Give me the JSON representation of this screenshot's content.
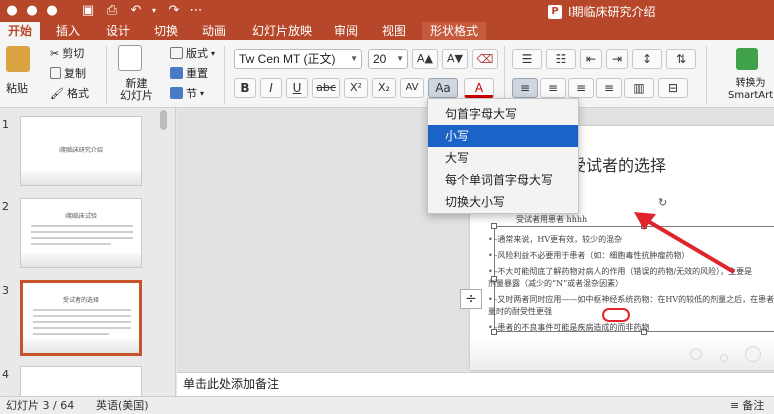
{
  "window": {
    "title": "I期临床研究介绍",
    "app_badge": "P"
  },
  "tabs": [
    "开始",
    "插入",
    "设计",
    "切换",
    "动画",
    "幻灯片放映",
    "审阅",
    "视图",
    "形状格式"
  ],
  "ribbon": {
    "paste": "粘贴",
    "cut": "剪切",
    "copy": "复制",
    "format": "格式",
    "new_slide": "新建\n幻灯片",
    "layout": "版式",
    "reset": "重置",
    "section": "节",
    "font_name": "Tw Cen MT (正文)",
    "font_size": "20",
    "bold": "B",
    "italic": "I",
    "underline": "U",
    "strike": "abc",
    "superscript": "X²",
    "subscript": "X₂",
    "char_spacing": "AV",
    "change_case": "Aa",
    "font_color": "A",
    "grow": "A▲",
    "shrink": "A▼",
    "convert_smartart": "转换为\nSmartArt"
  },
  "case_menu": {
    "items": [
      "句首字母大写",
      "小写",
      "大写",
      "每个单词首字母大写",
      "切换大小写"
    ],
    "hover_index": 1
  },
  "thumbnails": [
    {
      "num": "1",
      "title": "I期临床研究介绍"
    },
    {
      "num": "2",
      "title": "I期临床试验"
    },
    {
      "num": "3",
      "title": "受试者的选择"
    },
    {
      "num": "4",
      "title": ""
    }
  ],
  "slide": {
    "title": "受试者的选择",
    "lines": [
      "受试者用患者 hhhh",
      "-通常来说，HV更有效，较少的混杂",
      "-风险利益不必要用于患者（如：细胞毒性抗肿瘤药物）",
      "-不大可能彻底了解药物对病人的作用（错误的药物/无效的风险），主要是",
      "  剂量暴露（减少的“N”或者混杂因素）",
      "-又时两者同时应用——如中枢神经系统药物：在HV的较低的剂量之后，在患者中",
      "  量时的耐受性更强",
      "-患者的不良事件可能是疾病造成的而非药物"
    ]
  },
  "notes_placeholder": "单击此处添加备注",
  "status": {
    "slide_pos": "幻灯片 3 / 64",
    "language": "英语(美国)",
    "notes_btn": "备注"
  },
  "colors": {
    "brand": "#b7472a",
    "menu_hover": "#1b63c6",
    "annotation_red": "#e0242c"
  }
}
